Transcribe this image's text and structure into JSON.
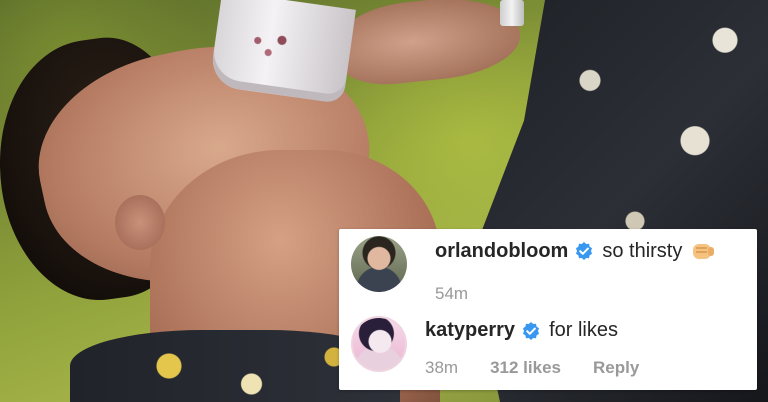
{
  "comments": [
    {
      "username": "orlandobloom",
      "text": "so thirsty",
      "emoji": "fist-bump-icon",
      "time": "54m",
      "likes": "",
      "reply": ""
    },
    {
      "username": "katyperry",
      "text": "for likes",
      "time": "38m",
      "likes": "312 likes",
      "reply": "Reply"
    }
  ],
  "colors": {
    "verified_badge": "#3897f0",
    "text_primary": "#262626",
    "text_meta": "#999999"
  }
}
